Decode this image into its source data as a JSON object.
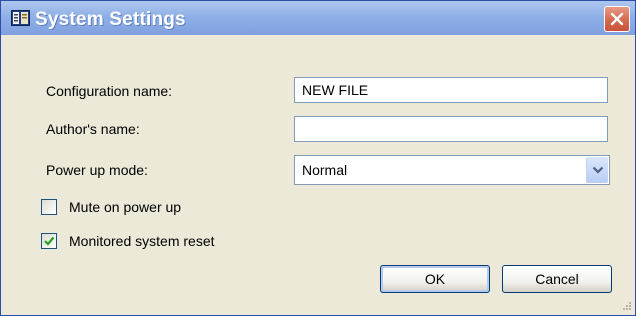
{
  "window": {
    "title": "System Settings",
    "close_label": "Close"
  },
  "form": {
    "config_name": {
      "label": "Configuration name:",
      "value": "NEW FILE"
    },
    "author_name": {
      "label": "Author's name:",
      "value": ""
    },
    "power_up_mode": {
      "label": "Power up mode:",
      "selected": "Normal"
    }
  },
  "options": {
    "mute_on_power_up": {
      "label": "Mute on power up",
      "checked": false
    },
    "monitored_reset": {
      "label": "Monitored system reset",
      "checked": true
    }
  },
  "buttons": {
    "ok_label": "OK",
    "cancel_label": "Cancel"
  },
  "colors": {
    "title_bar": "#8fb0e6",
    "dialog_bg": "#ece9d8",
    "close_button": "#d66a50",
    "checkmark": "#21a121"
  },
  "icons": {
    "title_icon": "settings-window-icon",
    "close_icon": "close-x-icon",
    "dropdown_icon": "chevron-down-icon",
    "check_icon": "checkmark-icon",
    "grip_icon": "resize-grip-icon"
  }
}
